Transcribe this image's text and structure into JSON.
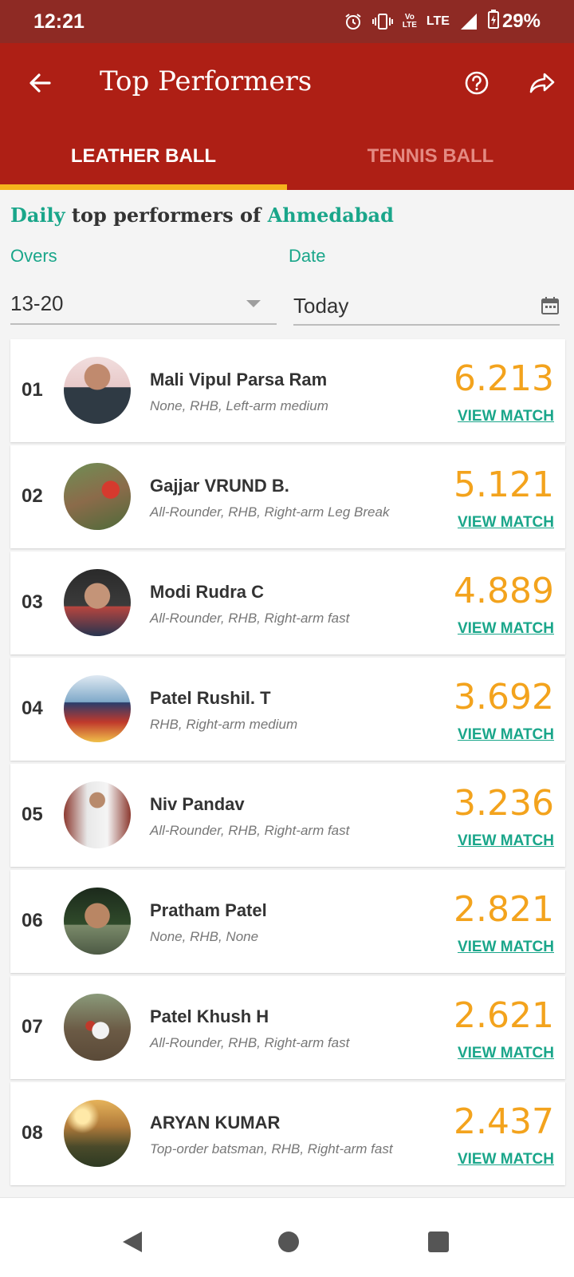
{
  "status": {
    "time": "12:21",
    "network": "LTE",
    "volte_top": "Vo",
    "volte_bottom": "LTE",
    "battery": "29%",
    "icons": [
      "alarm-icon",
      "vibrate-icon",
      "volte-icon",
      "lte-icon",
      "signal-icon",
      "battery-icon"
    ]
  },
  "app_bar": {
    "title": "Top Performers",
    "icons": [
      "back-arrow-icon",
      "help-icon",
      "share-icon"
    ]
  },
  "tabs": [
    {
      "label": "LEATHER BALL",
      "active": true
    },
    {
      "label": "TENNIS BALL",
      "active": false
    }
  ],
  "heading": {
    "part1": "Daily",
    "part2": " top performers of ",
    "part3": "Ahmedabad"
  },
  "filters": {
    "overs_label": "Overs",
    "overs_value": "13-20",
    "date_label": "Date",
    "date_value": "Today"
  },
  "performers": [
    {
      "rank": "01",
      "name": "Mali Vipul Parsa Ram",
      "desc": "None, RHB, Left-arm medium",
      "score": "6.213",
      "link": "VIEW MATCH"
    },
    {
      "rank": "02",
      "name": "Gajjar VRUND B.",
      "desc": "All-Rounder, RHB, Right-arm Leg Break",
      "score": "5.121",
      "link": "VIEW MATCH"
    },
    {
      "rank": "03",
      "name": "Modi Rudra C",
      "desc": "All-Rounder, RHB, Right-arm fast",
      "score": "4.889",
      "link": "VIEW MATCH"
    },
    {
      "rank": "04",
      "name": "Patel Rushil. T",
      "desc": "RHB, Right-arm medium",
      "score": "3.692",
      "link": "VIEW MATCH"
    },
    {
      "rank": "05",
      "name": "Niv Pandav",
      "desc": "All-Rounder, RHB, Right-arm fast",
      "score": "3.236",
      "link": "VIEW MATCH"
    },
    {
      "rank": "06",
      "name": "Pratham Patel",
      "desc": "None, RHB, None",
      "score": "2.821",
      "link": "VIEW MATCH"
    },
    {
      "rank": "07",
      "name": "Patel Khush H",
      "desc": "All-Rounder, RHB, Right-arm fast",
      "score": "2.621",
      "link": "VIEW MATCH"
    },
    {
      "rank": "08",
      "name": "ARYAN KUMAR",
      "desc": "Top-order batsman, RHB, Right-arm fast",
      "score": "2.437",
      "link": "VIEW MATCH"
    }
  ],
  "nav": {
    "icons": [
      "nav-back-icon",
      "nav-home-icon",
      "nav-recents-icon"
    ]
  },
  "colors": {
    "status_bar": "#8e2a24",
    "app_bar": "#ae1f15",
    "accent_green": "#1aa68a",
    "score_orange": "#f3a31d",
    "tab_indicator": "#f6b31c"
  }
}
